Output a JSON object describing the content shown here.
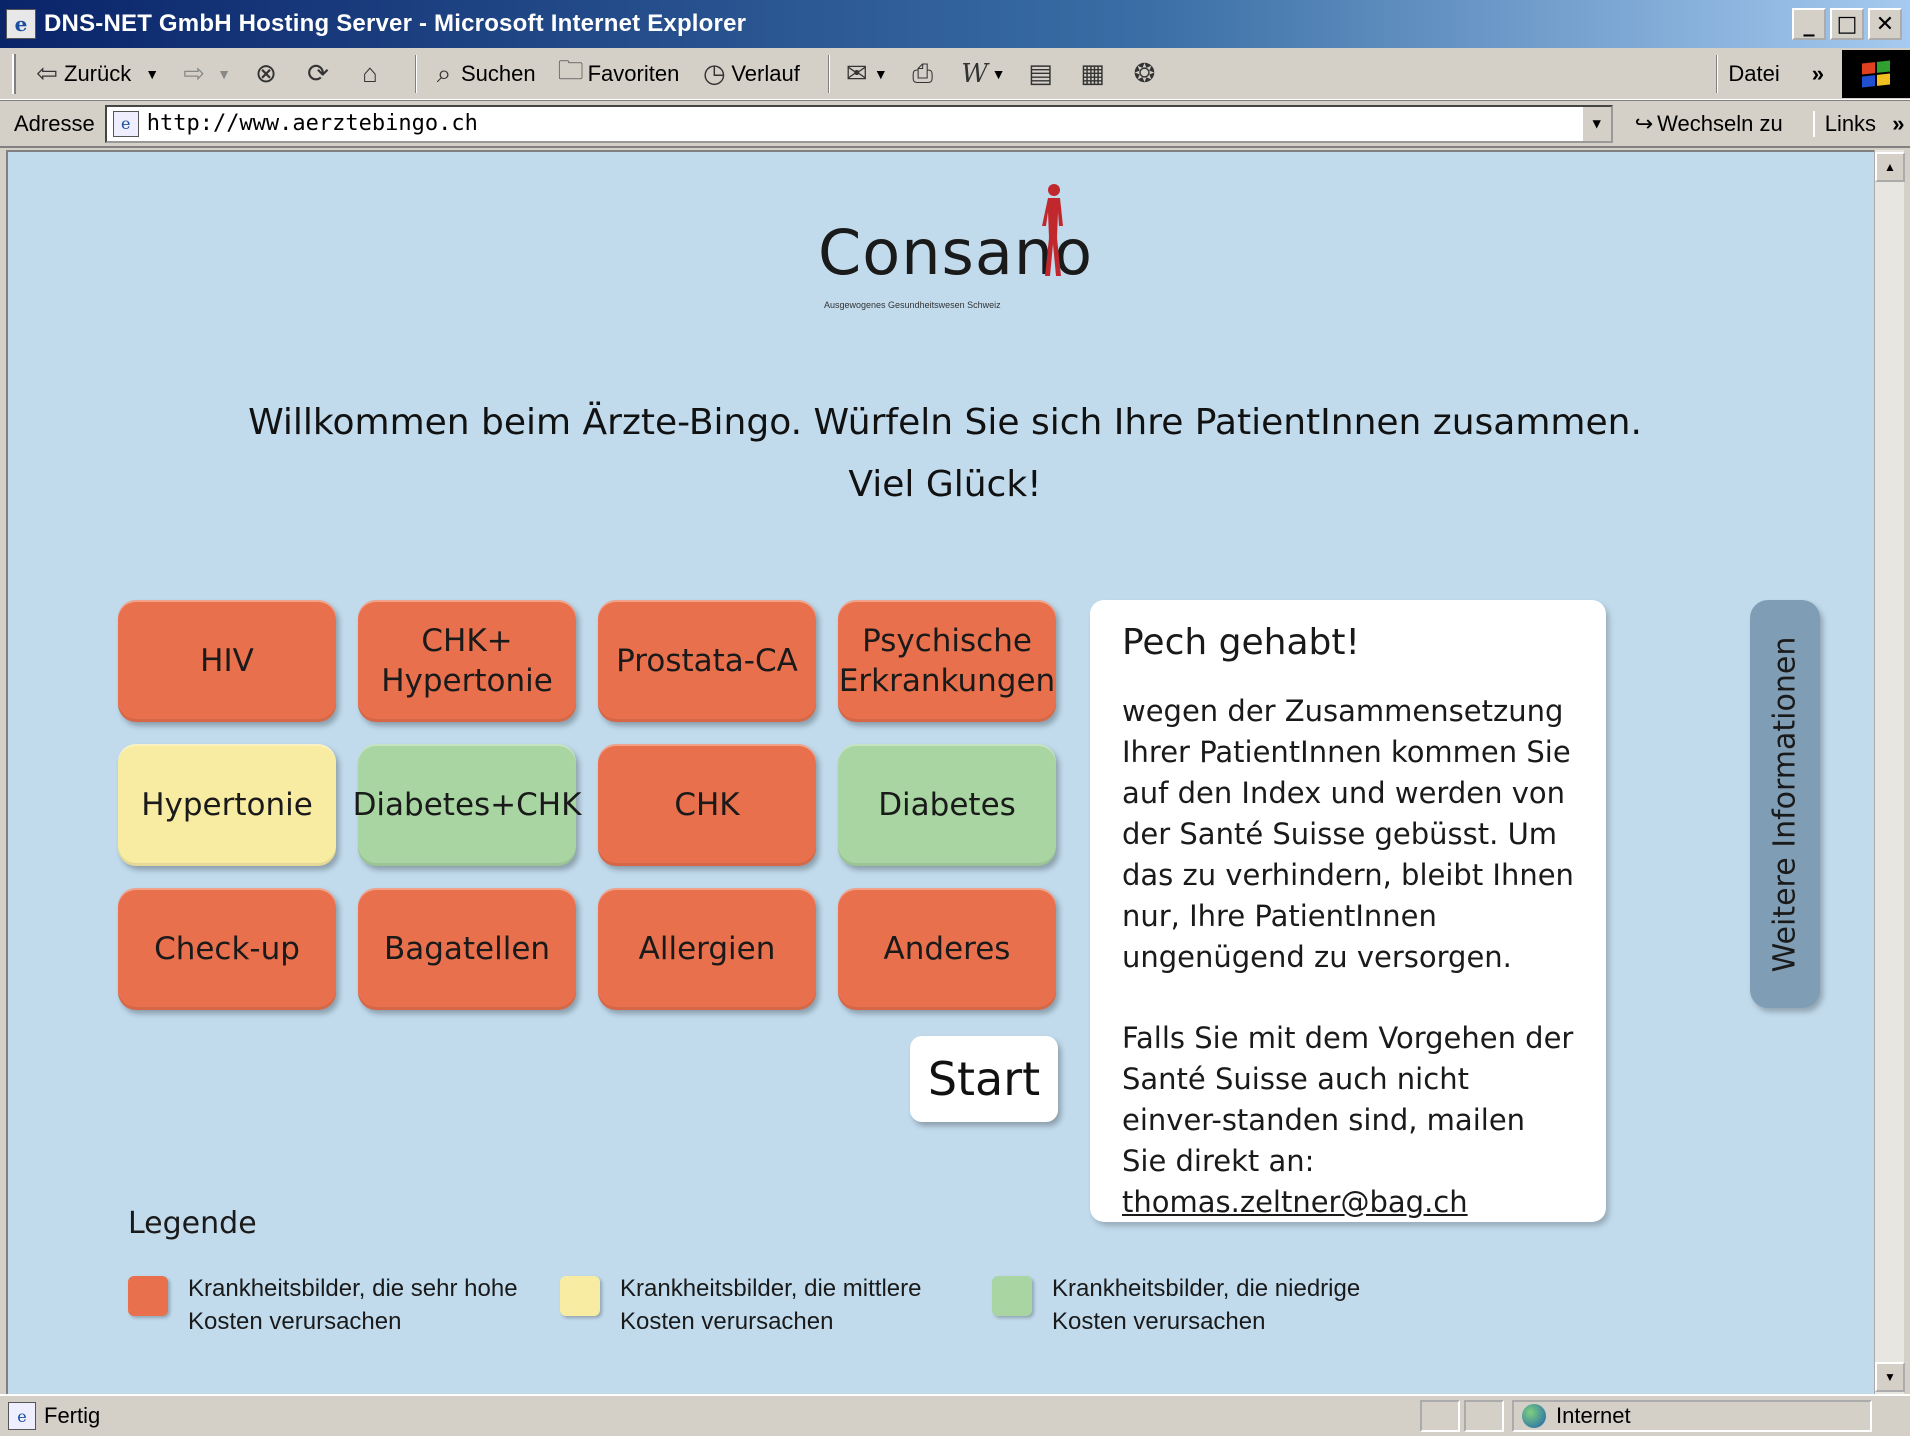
{
  "window": {
    "title": "DNS-NET GmbH Hosting Server - Microsoft Internet Explorer",
    "minimize": "_",
    "maximize": "□",
    "close": "✕"
  },
  "toolbar": {
    "back_label": "Zurück",
    "search_label": "Suchen",
    "favorites_label": "Favoriten",
    "history_label": "Verlauf",
    "menu_datei": "Datei",
    "more": "»"
  },
  "address": {
    "label": "Adresse",
    "url": "http://www.aerztebingo.ch",
    "go_label": "Wechseln zu",
    "links_label": "Links"
  },
  "status": {
    "text": "Fertig",
    "zone": "Internet"
  },
  "page": {
    "logo_text": "Consano",
    "logo_tagline": "Ausgewogenes Gesundheitswesen Schweiz",
    "welcome_line1": "Willkommen beim Ärzte-Bingo. Würfeln Sie sich Ihre PatientInnen zusammen.",
    "welcome_line2": "Viel Glück!",
    "start_label": "Start",
    "side_tab_label": "Weitere Informationen",
    "message": {
      "title": "Pech gehabt!",
      "paragraph1": "wegen der Zusammensetzung Ihrer PatientInnen kommen Sie auf den Index und werden von der Santé Suisse gebüsst. Um das zu verhindern, bleibt Ihnen nur, Ihre PatientInnen ungenügend zu versorgen.",
      "paragraph2": "Falls Sie mit dem Vorgehen der Santé Suisse auch nicht einver-standen sind, mailen Sie direkt an:",
      "email": "thomas.zeltner@bag.ch"
    },
    "tiles": [
      {
        "label": "HIV",
        "cost": "high"
      },
      {
        "label": "CHK+ Hypertonie",
        "cost": "high"
      },
      {
        "label": "Prostata-CA",
        "cost": "high"
      },
      {
        "label": "Psychische Erkrankungen",
        "cost": "high"
      },
      {
        "label": "Hypertonie",
        "cost": "mid"
      },
      {
        "label": "Diabetes+CHK",
        "cost": "low"
      },
      {
        "label": "CHK",
        "cost": "high"
      },
      {
        "label": "Diabetes",
        "cost": "low"
      },
      {
        "label": "Check-up",
        "cost": "high"
      },
      {
        "label": "Bagatellen",
        "cost": "high"
      },
      {
        "label": "Allergien",
        "cost": "high"
      },
      {
        "label": "Anderes",
        "cost": "high"
      }
    ],
    "legend": {
      "title": "Legende",
      "items": [
        {
          "text": "Krankheitsbilder, die sehr hohe Kosten verursachen",
          "color": "#e8704d"
        },
        {
          "text": "Krankheitsbilder, die mittlere Kosten verursachen",
          "color": "#f8eca3"
        },
        {
          "text": "Krankheitsbilder, die niedrige Kosten verursachen",
          "color": "#a8d5a2"
        }
      ]
    }
  },
  "colors": {
    "background": "#c1dbed",
    "high_cost": "#e8704d",
    "mid_cost": "#f8eca3",
    "low_cost": "#a8d5a2",
    "side_tab": "#7f9db4",
    "logo_figure": "#c0282d"
  }
}
